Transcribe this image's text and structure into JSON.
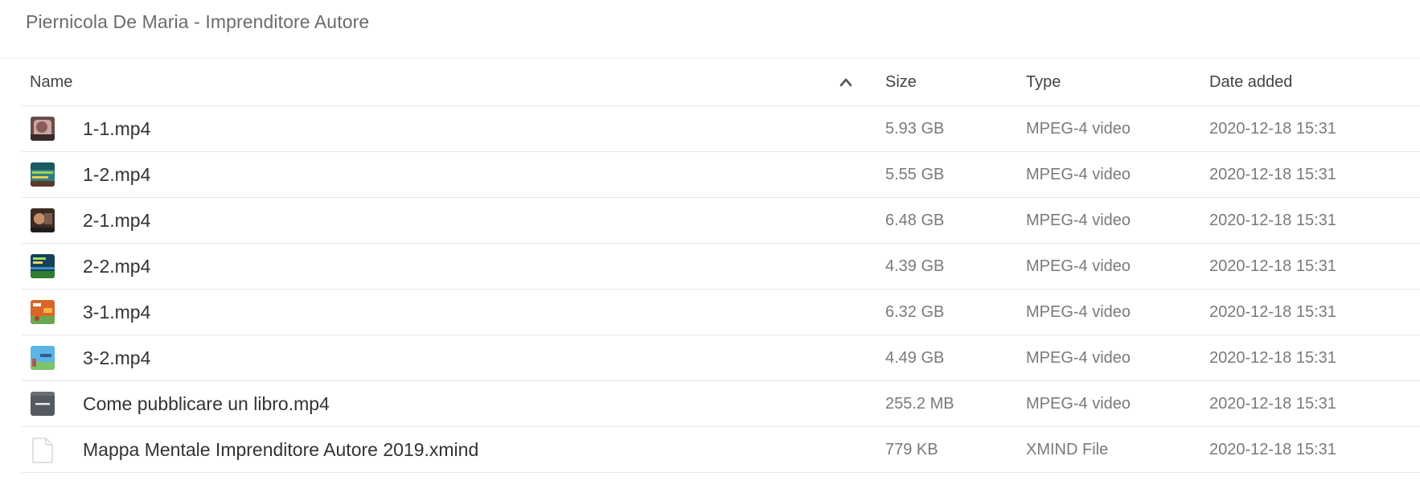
{
  "folder_title": "Piernicola De Maria - Imprenditore Autore",
  "columns": {
    "name": "Name",
    "size": "Size",
    "type": "Type",
    "date": "Date added",
    "sort_icon": "chevron-up-icon"
  },
  "files": [
    {
      "name": "1-1.mp4",
      "size": "5.93 GB",
      "type": "MPEG-4 video",
      "date": "2020-12-18 15:31",
      "icon": "video-thumbnail-icon"
    },
    {
      "name": "1-2.mp4",
      "size": "5.55 GB",
      "type": "MPEG-4 video",
      "date": "2020-12-18 15:31",
      "icon": "video-thumbnail-icon"
    },
    {
      "name": "2-1.mp4",
      "size": "6.48 GB",
      "type": "MPEG-4 video",
      "date": "2020-12-18 15:31",
      "icon": "video-thumbnail-icon"
    },
    {
      "name": "2-2.mp4",
      "size": "4.39 GB",
      "type": "MPEG-4 video",
      "date": "2020-12-18 15:31",
      "icon": "video-thumbnail-icon"
    },
    {
      "name": "3-1.mp4",
      "size": "6.32 GB",
      "type": "MPEG-4 video",
      "date": "2020-12-18 15:31",
      "icon": "video-thumbnail-icon"
    },
    {
      "name": "3-2.mp4",
      "size": "4.49 GB",
      "type": "MPEG-4 video",
      "date": "2020-12-18 15:31",
      "icon": "video-thumbnail-icon"
    },
    {
      "name": "Come pubblicare un libro.mp4",
      "size": "255.2 MB",
      "type": "MPEG-4 video",
      "date": "2020-12-18 15:31",
      "icon": "video-thumbnail-icon"
    },
    {
      "name": "Mappa Mentale Imprenditore Autore 2019.xmind",
      "size": "779 KB",
      "type": "XMIND File",
      "date": "2020-12-18 15:31",
      "icon": "document-icon"
    }
  ]
}
